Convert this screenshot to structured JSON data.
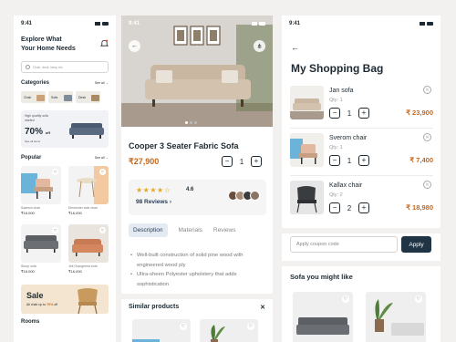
{
  "colors": {
    "accent": "#c7681a",
    "primary": "#1f3445",
    "star": "#e4a825"
  },
  "home": {
    "time": "9:41",
    "title_line1": "Explore What",
    "title_line2": "Your Home Needs",
    "search_placeholder": "Chair, desk, lamp etc",
    "categories_title": "Categories",
    "see_all": "See all",
    "categories": [
      "Chair",
      "Sofa",
      "Desk"
    ],
    "banner": {
      "text": "High quality sofa started",
      "percent": "70%",
      "off": "off",
      "link": "See all items"
    },
    "popular_title": "Popular",
    "products": [
      {
        "name": "Saarwin chair",
        "price": "₹16,000"
      },
      {
        "name": "Elementer side chair",
        "price": "₹16,000"
      },
      {
        "name": "Stoop sofa",
        "price": "₹16,000"
      },
      {
        "name": "Jeti Orangerest sofa",
        "price": "₹16,000"
      }
    ],
    "sale": {
      "title": "Sale",
      "line_prefix": "All chair up to",
      "percent": "70%",
      "line_suffix": "off"
    },
    "rooms_title": "Rooms"
  },
  "detail": {
    "time": "9:41",
    "title": "Cooper 3 Seater Fabric Sofa",
    "price": "₹27,900",
    "quantity": "1",
    "stars": "★★★★☆",
    "rating": "4.6",
    "reviews_link": "98 Reviews ›",
    "tabs": [
      "Description",
      "Materials",
      "Reviews"
    ],
    "bullets": [
      "Well-built construction of solid pine wood with engineered wood ply",
      "Ultra-sheen Polyester upholstery that adds sophistication"
    ],
    "similar_title": "Similar products"
  },
  "bag": {
    "time": "9:41",
    "title": "My Shopping Bag",
    "items": [
      {
        "name": "Jan sofa",
        "qty_label": "Qty: 1",
        "qty": "1",
        "price": "₹ 23,900"
      },
      {
        "name": "Sverom chair",
        "qty_label": "Qty: 1",
        "qty": "1",
        "price": "₹ 7,400"
      },
      {
        "name": "Kallax chair",
        "qty_label": "Qty: 2",
        "qty": "2",
        "price": "₹ 18,980"
      }
    ],
    "coupon_placeholder": "Apply coupon code",
    "apply_label": "Apply",
    "you_like_title": "Sofa you might like"
  }
}
